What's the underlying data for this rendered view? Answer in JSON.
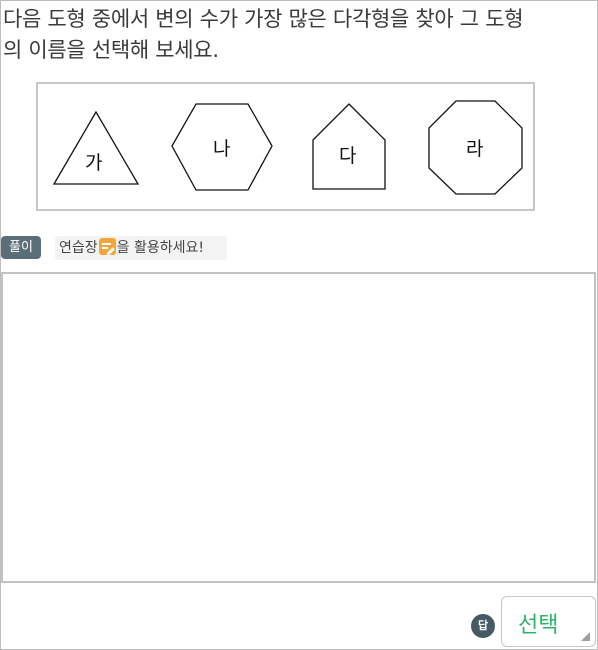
{
  "question": {
    "line1": "다음 도형 중에서 변의 수가 가장 많은 다각형을 찾아 그 도형",
    "line2": "의 이름을 선택해 보세요."
  },
  "shapes": [
    {
      "label": "가",
      "type": "triangle"
    },
    {
      "label": "나",
      "type": "hexagon"
    },
    {
      "label": "다",
      "type": "pentagon"
    },
    {
      "label": "라",
      "type": "octagon"
    }
  ],
  "solution": {
    "badge": "풀이",
    "hint_before": "연습장",
    "hint_after": "을 활용하세요!",
    "hint_icon": "notepad-pencil-icon",
    "icon_color": "#f3a53a"
  },
  "answer": {
    "badge": "답",
    "select_label": "선택",
    "select_color": "#2fb36a"
  }
}
